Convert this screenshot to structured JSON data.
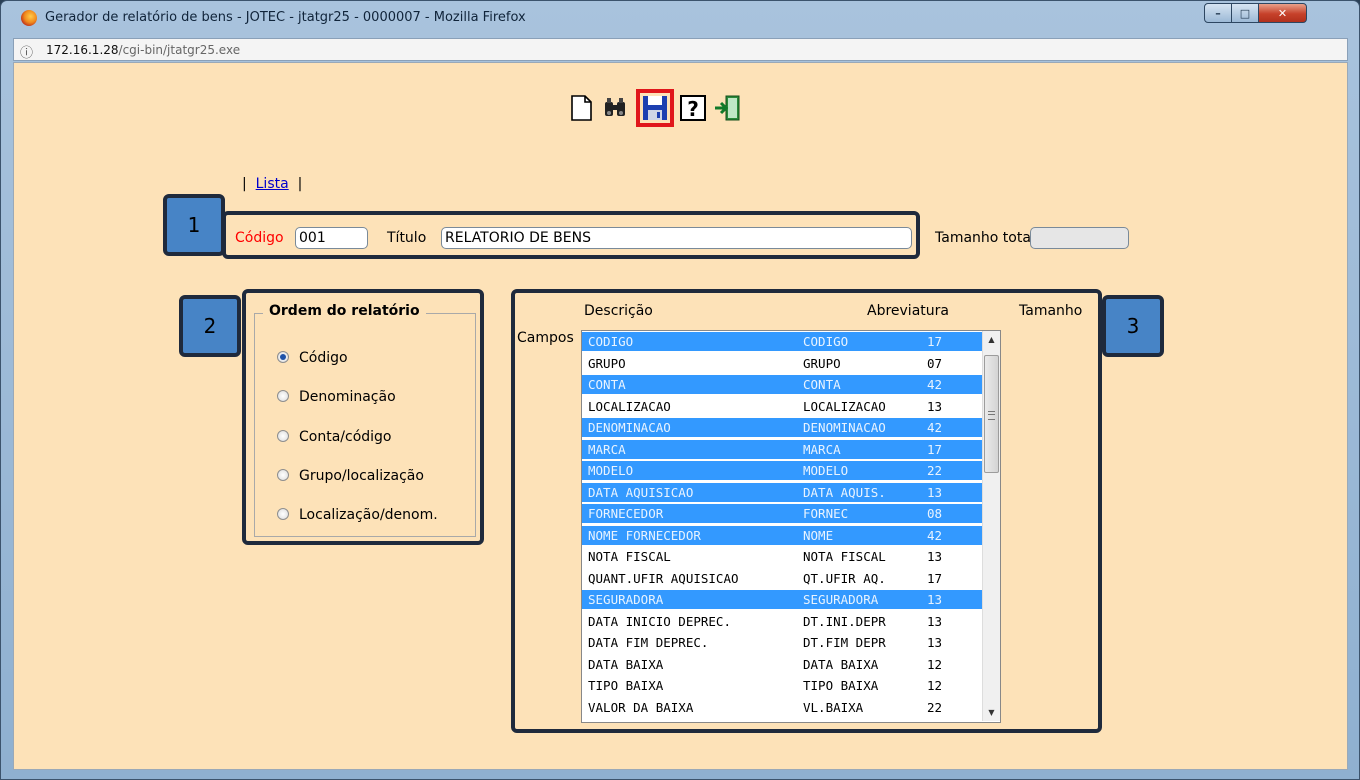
{
  "window": {
    "title": "Gerador de relatório de bens - JOTEC - jtatgr25 - 0000007 - Mozilla Firefox",
    "url_host": "172.16.1.28",
    "url_path": "/cgi-bin/jtatgr25.exe"
  },
  "toolbar": {
    "items": [
      "new-icon",
      "binoculars-icon",
      "save-icon",
      "help-icon",
      "exit-icon"
    ]
  },
  "nav": {
    "sep_left": "|",
    "lista_link": "Lista",
    "sep_right": "|"
  },
  "form": {
    "codigo_label": "Código",
    "codigo_value": "001",
    "titulo_label": "Título",
    "titulo_value": "RELATORIO DE BENS",
    "tamanho_total_label": "Tamanho total",
    "tamanho_total_value": ""
  },
  "badges": [
    "1",
    "2",
    "3"
  ],
  "ordem": {
    "legend": "Ordem do relatório",
    "selected": "Código",
    "options": [
      "Código",
      "Denominação",
      "Conta/código",
      "Grupo/localização",
      "Localização/denom."
    ]
  },
  "campos": {
    "label": "Campos",
    "headers": [
      "Descrição",
      "Abreviatura",
      "Tamanho"
    ],
    "rows": [
      {
        "desc": "CODIGO",
        "abrev": "CODIGO",
        "tam": "17",
        "selected": true
      },
      {
        "desc": "GRUPO",
        "abrev": "GRUPO",
        "tam": "07",
        "selected": false
      },
      {
        "desc": "CONTA",
        "abrev": "CONTA",
        "tam": "42",
        "selected": true
      },
      {
        "desc": "LOCALIZACAO",
        "abrev": "LOCALIZACAO",
        "tam": "13",
        "selected": false
      },
      {
        "desc": "DENOMINACAO",
        "abrev": "DENOMINACAO",
        "tam": "42",
        "selected": true
      },
      {
        "desc": "MARCA",
        "abrev": "MARCA",
        "tam": "17",
        "selected": true
      },
      {
        "desc": "MODELO",
        "abrev": "MODELO",
        "tam": "22",
        "selected": true
      },
      {
        "desc": "DATA AQUISICAO",
        "abrev": "DATA AQUIS.",
        "tam": "13",
        "selected": true
      },
      {
        "desc": "FORNECEDOR",
        "abrev": "FORNEC",
        "tam": "08",
        "selected": true
      },
      {
        "desc": "NOME FORNECEDOR",
        "abrev": "NOME",
        "tam": "42",
        "selected": true
      },
      {
        "desc": "NOTA FISCAL",
        "abrev": "NOTA FISCAL",
        "tam": "13",
        "selected": false
      },
      {
        "desc": "QUANT.UFIR AQUISICAO",
        "abrev": "QT.UFIR AQ.",
        "tam": "17",
        "selected": false
      },
      {
        "desc": "SEGURADORA",
        "abrev": "SEGURADORA",
        "tam": "13",
        "selected": true
      },
      {
        "desc": "DATA INICIO DEPREC.",
        "abrev": "DT.INI.DEPR",
        "tam": "13",
        "selected": false
      },
      {
        "desc": "DATA FIM DEPREC.",
        "abrev": "DT.FIM DEPR",
        "tam": "13",
        "selected": false
      },
      {
        "desc": "DATA BAIXA",
        "abrev": "DATA BAIXA",
        "tam": "12",
        "selected": false
      },
      {
        "desc": "TIPO BAIXA",
        "abrev": "TIPO BAIXA",
        "tam": "12",
        "selected": false
      },
      {
        "desc": "VALOR DA BAIXA",
        "abrev": "VL.BAIXA",
        "tam": "22",
        "selected": false
      }
    ]
  },
  "colors": {
    "page_bg": "#fde2b8",
    "selection": "#3399ff",
    "required_label": "#ff0000",
    "highlight_box": "#e0161b",
    "badge_fill": "#4784c6"
  }
}
